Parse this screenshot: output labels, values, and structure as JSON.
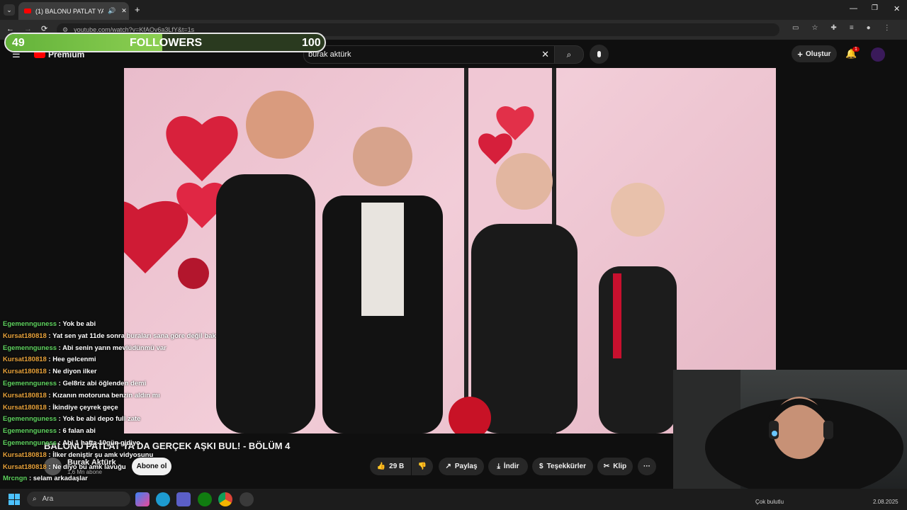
{
  "browser": {
    "tab_title": "(1) BALONU PATLAT YA DA",
    "url": "youtube.com/watch?v=KfAOv6a3LfY&t=1s"
  },
  "youtube": {
    "logo_text": "Premium",
    "search_value": "burak aktürk",
    "create_label": "Oluştur",
    "notif_count": "1"
  },
  "followers": {
    "current": "49",
    "label": "FOLLOWERS",
    "goal": "100",
    "progress": 0.49
  },
  "chat": [
    {
      "user": "Egemennguness",
      "msg": "Yok be abi",
      "color": "#5fd35f"
    },
    {
      "user": "Kursat180818",
      "msg": "Yat sen yat 11de sonra buraları sana göre değil bak",
      "color": "#e8a23a"
    },
    {
      "user": "Egemennguness",
      "msg": "Abi senin yarın mevlüdünmü var",
      "color": "#5fd35f"
    },
    {
      "user": "Kursat180818",
      "msg": "Hee gelcenmi",
      "color": "#e8a23a"
    },
    {
      "user": "Kursat180818",
      "msg": "Ne diyon ilker",
      "color": "#e8a23a"
    },
    {
      "user": "Egemennguness",
      "msg": "Gel8riz abi öğlenden demi",
      "color": "#5fd35f"
    },
    {
      "user": "Kursat180818",
      "msg": "Kızanın motoruna benzin aldın mı",
      "color": "#e8a23a"
    },
    {
      "user": "Kursat180818",
      "msg": "İkindiye çeyrek geçe",
      "color": "#e8a23a"
    },
    {
      "user": "Egemennguness",
      "msg": "Yok be abi depo full zate",
      "color": "#5fd35f"
    },
    {
      "user": "Egemennguness",
      "msg": "6 falan abi",
      "color": "#5fd35f"
    },
    {
      "user": "Egemennguness",
      "msg": "Abi 1 hafta 10gün gidiyo",
      "color": "#5fd35f"
    },
    {
      "user": "Kursat180818",
      "msg": "İlker deniştir şu amk vidyosunu",
      "color": "#e8a23a"
    },
    {
      "user": "Kursat180818",
      "msg": "Ne diyo bu amk lavuğu",
      "color": "#e8a23a"
    },
    {
      "user": "Mrcngn",
      "msg": "selam arkadaşlar",
      "color": "#5fd35f"
    }
  ],
  "video": {
    "title": "BALONU PATLAT YA DA GERÇEK AŞKI BUL! - BÖLÜM 4",
    "channel": "Burak Aktürk",
    "subs": "1,6 Mn abone",
    "subscribe": "Abone ol",
    "likes": "29 B",
    "share": "Paylaş",
    "download": "İndir",
    "thanks": "Teşekkürler",
    "clip": "Klip",
    "more": "···"
  },
  "taskbar": {
    "search": "Ara",
    "weather": "Çok bulutlu",
    "date": "2.08.2025"
  }
}
